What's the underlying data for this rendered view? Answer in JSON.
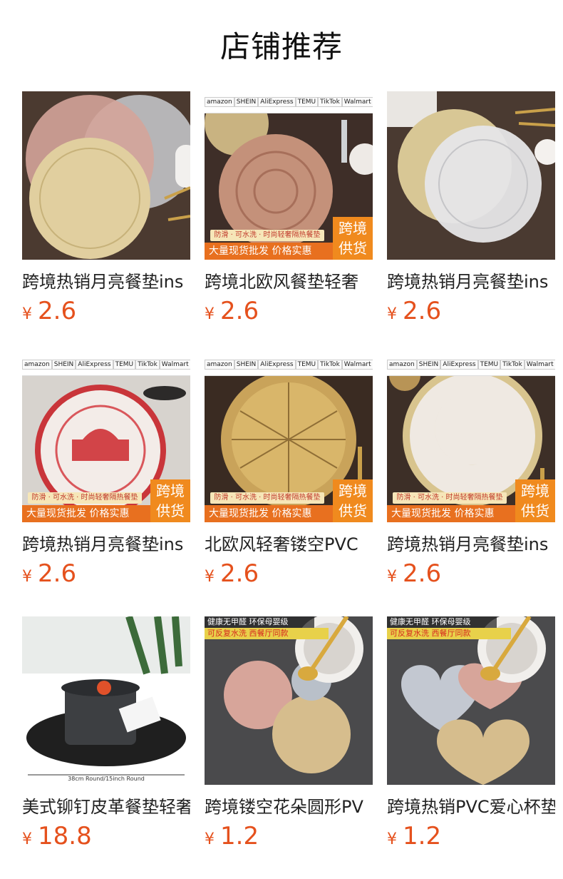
{
  "page": {
    "title": "店铺推荐"
  },
  "platform_badges": [
    "amazon",
    "SHEIN",
    "AliExpress",
    "TEMU",
    "TikTok",
    "Walmart"
  ],
  "banner": {
    "features": "防滑 · 可水洗 · 时尚轻奢隔热餐垫",
    "wholesale": "大量现货批发  价格实惠",
    "cross_border": "跨境供货"
  },
  "overlay": {
    "line1": "健康无甲醛 环保母婴级",
    "line2": "可反复水洗 西餐厅同款"
  },
  "size_note": "38cm Round/15inch Round",
  "currency": "¥",
  "colors": {
    "price": "#e5511d",
    "banner_orange": "#e8701f"
  },
  "products": [
    {
      "name": "跨境热销月亮餐垫ins",
      "price": "2.6"
    },
    {
      "name": "跨境北欧风餐垫轻奢",
      "price": "2.6"
    },
    {
      "name": "跨境热销月亮餐垫ins",
      "price": "2.6"
    },
    {
      "name": "跨境热销月亮餐垫ins",
      "price": "2.6"
    },
    {
      "name": "北欧风轻奢镂空PVC",
      "price": "2.6"
    },
    {
      "name": "跨境热销月亮餐垫ins",
      "price": "2.6"
    },
    {
      "name": "美式铆钉皮革餐垫轻奢",
      "price": "18.8"
    },
    {
      "name": "跨境镂空花朵圆形PV",
      "price": "1.2"
    },
    {
      "name": "跨境热销PVC爱心杯垫",
      "price": "1.2"
    }
  ]
}
